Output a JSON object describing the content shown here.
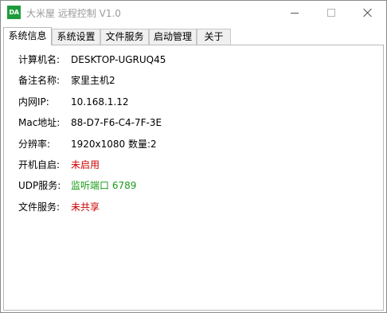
{
  "window": {
    "icon_text": "DA",
    "title": "大米屋 远程控制 V1.0"
  },
  "tabs": [
    {
      "label": "系统信息",
      "active": true
    },
    {
      "label": "系统设置",
      "active": false
    },
    {
      "label": "文件服务",
      "active": false
    },
    {
      "label": "启动管理",
      "active": false
    },
    {
      "label": "关于",
      "active": false
    }
  ],
  "info": {
    "computer_name_label": "计算机名:",
    "computer_name": "DESKTOP-UGRUQ45",
    "remark_label": "备注名称:",
    "remark": "家里主机2",
    "lan_ip_label": "内网IP:",
    "lan_ip": "10.168.1.12",
    "mac_label": "Mac地址:",
    "mac": "88-D7-F6-C4-7F-3E",
    "resolution_label": "分辨率:",
    "resolution": "1920x1080  数量:2",
    "autostart_label": "开机自启:",
    "autostart": "未启用",
    "udp_label": "UDP服务:",
    "udp": "监听端口 6789",
    "file_service_label": "文件服务:",
    "file_service": "未共享"
  },
  "colors": {
    "disabled_text": "#cc0000",
    "enabled_text": "#1a9a1a",
    "icon_bg": "#1e9c3c"
  }
}
